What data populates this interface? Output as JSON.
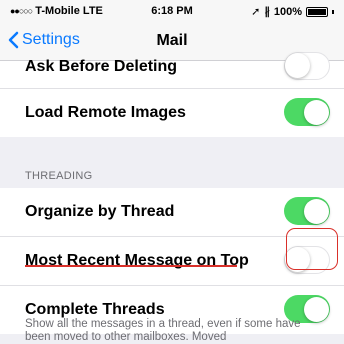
{
  "status_bar": {
    "carrier": "T-Mobile  LTE",
    "time": "6:18 PM",
    "battery": "100%"
  },
  "nav": {
    "back_label": "Settings",
    "title": "Mail"
  },
  "top_rows": [
    {
      "label": "Ask Before Deleting",
      "toggle": "off"
    },
    {
      "label": "Load Remote Images",
      "toggle": "on"
    }
  ],
  "threading": {
    "header": "THREADING",
    "rows": [
      {
        "label": "Organize by Thread",
        "toggle": "on"
      },
      {
        "label": "Most Recent Message on Top",
        "toggle": "off"
      },
      {
        "label": "Complete Threads",
        "toggle": "on"
      }
    ],
    "footer": "Show all the messages in a thread, even if some have been moved to other mailboxes. Moved"
  },
  "colors": {
    "accent": "#0a7aff",
    "toggle_on": "#4cd964",
    "annotation": "#d9302a"
  }
}
